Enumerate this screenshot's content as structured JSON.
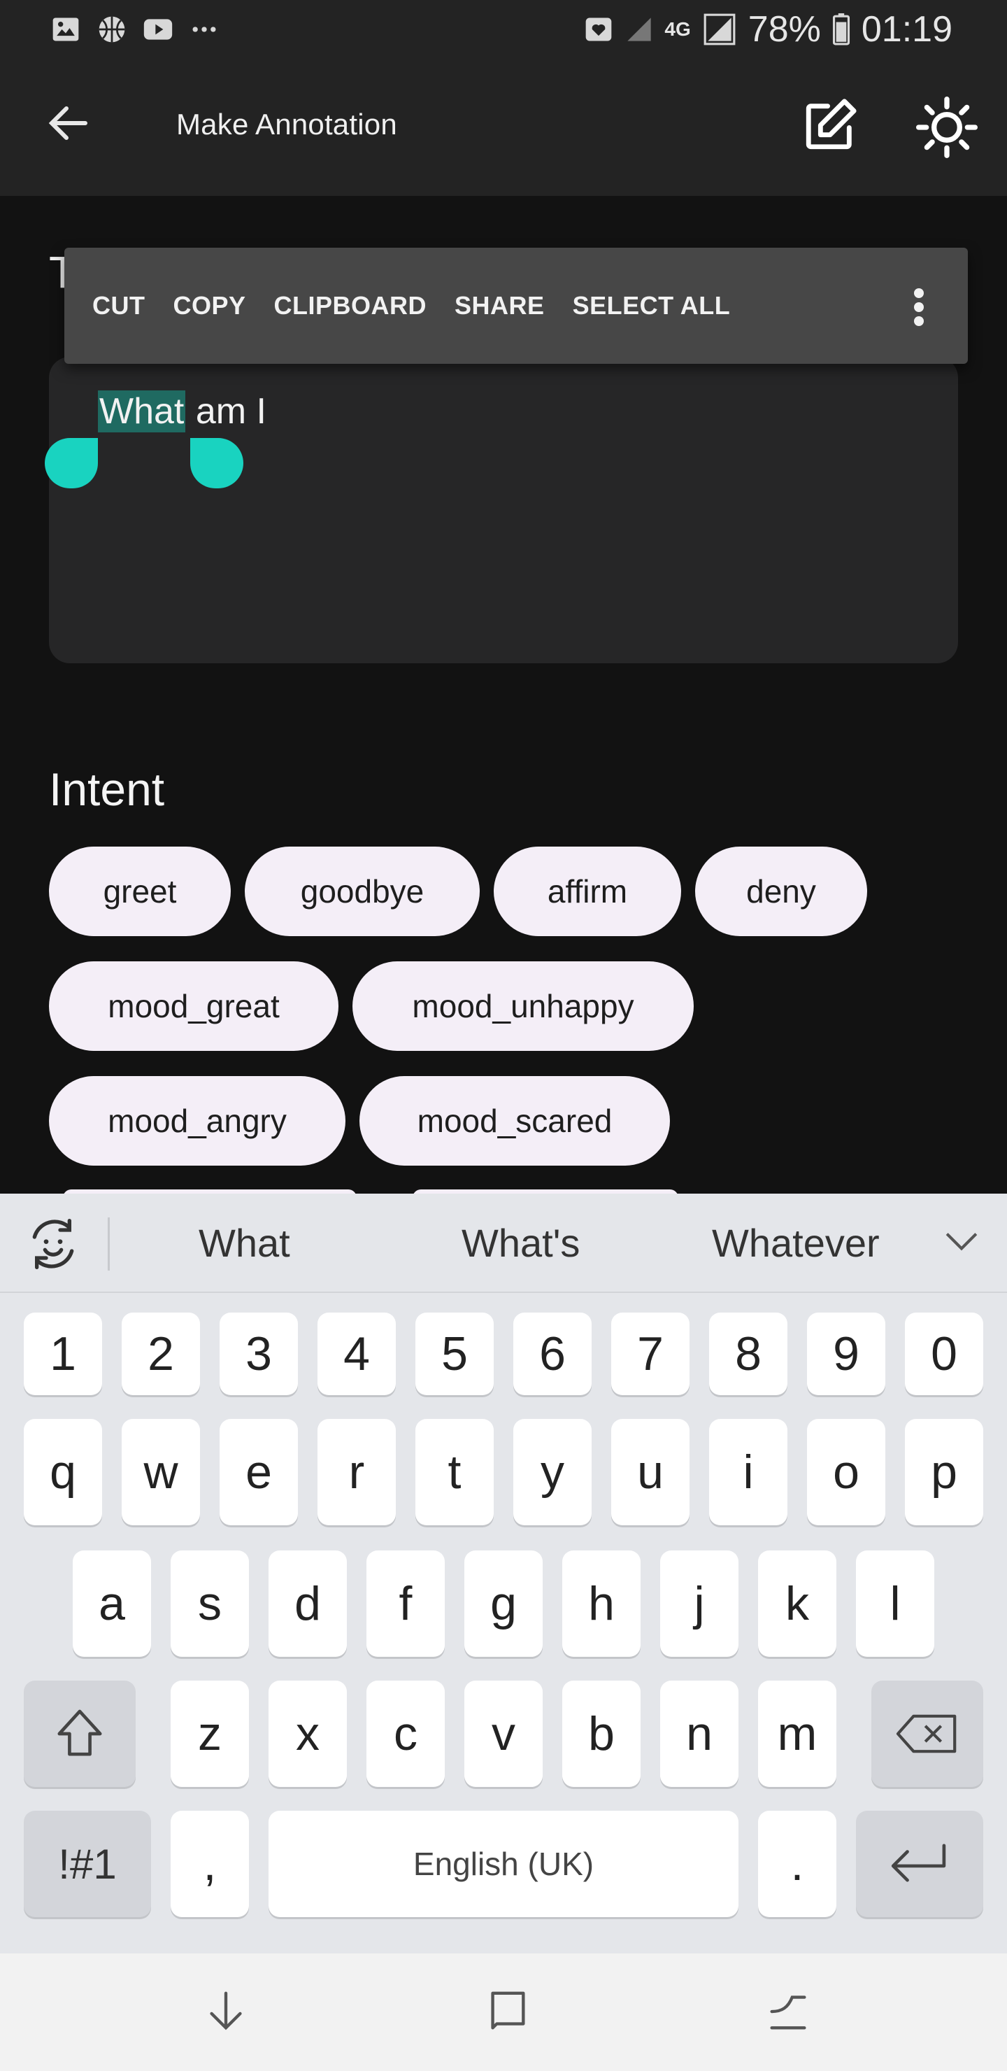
{
  "status_bar": {
    "left_icons": [
      "gallery-icon",
      "basketball-icon",
      "youtube-icon",
      "more-dots-icon"
    ],
    "network": "4G",
    "battery": "78%",
    "time": "01:19"
  },
  "app_bar": {
    "title": "Make Annotation",
    "icons": [
      "back-arrow-icon",
      "edit-icon",
      "brightness-icon"
    ]
  },
  "text_field": {
    "partial_label": "T",
    "selected_word": "What",
    "rest_text": " am I"
  },
  "context_menu": {
    "items": [
      "CUT",
      "COPY",
      "CLIPBOARD",
      "SHARE",
      "SELECT ALL"
    ]
  },
  "intent": {
    "label": "Intent",
    "chips": [
      "greet",
      "goodbye",
      "affirm",
      "deny",
      "mood_great",
      "mood_unhappy",
      "mood_angry",
      "mood_scared"
    ]
  },
  "keyboard": {
    "suggestions": [
      "What",
      "What's",
      "Whatever"
    ],
    "row_numbers": [
      "1",
      "2",
      "3",
      "4",
      "5",
      "6",
      "7",
      "8",
      "9",
      "0"
    ],
    "row_1": [
      "q",
      "w",
      "e",
      "r",
      "t",
      "y",
      "u",
      "i",
      "o",
      "p"
    ],
    "row_2": [
      "a",
      "s",
      "d",
      "f",
      "g",
      "h",
      "j",
      "k",
      "l"
    ],
    "row_3": [
      "z",
      "x",
      "c",
      "v",
      "b",
      "n",
      "m"
    ],
    "symbols_key": "!#1",
    "comma_key": ",",
    "space_label": "English (UK)",
    "period_key": "."
  },
  "accent_color": "#19d3c0"
}
